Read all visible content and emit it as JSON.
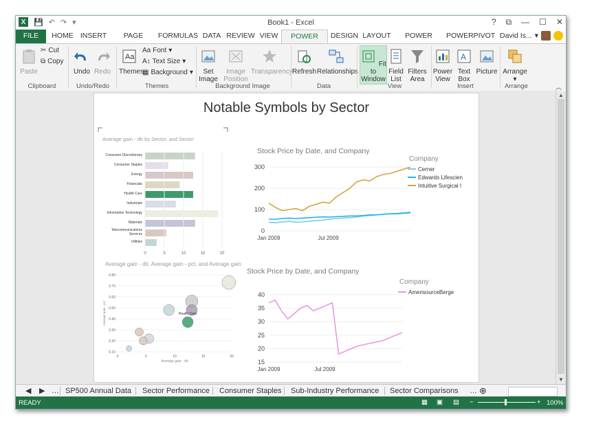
{
  "title_bar": {
    "title": "Book1 - Excel",
    "app_logo": "X",
    "controls": {
      "help": "?",
      "restore_ribbon": "⧉",
      "minimize": "—",
      "maximize": "☐",
      "close": "✕"
    }
  },
  "tabs": [
    "FILE",
    "HOME",
    "INSERT",
    "PAGE LAYOUT",
    "FORMULAS",
    "DATA",
    "REVIEW",
    "VIEW",
    "POWER VIEW",
    "DESIGN",
    "LAYOUT",
    "POWER QUERY",
    "POWERPIVOT"
  ],
  "active_tab": "POWER VIEW",
  "user": {
    "name": "David Is..."
  },
  "ribbon": {
    "clipboard": {
      "paste": "Paste",
      "cut": "Cut",
      "copy": "Copy",
      "label": "Clipboard"
    },
    "undoredo": {
      "undo": "Undo",
      "redo": "Redo",
      "label": "Undo/Redo"
    },
    "themes": {
      "themes": "Themes",
      "font": "Font",
      "text_size": "Text Size",
      "background": "Background",
      "label": "Themes"
    },
    "background_image": {
      "set_image_1": "Set",
      "set_image_2": "Image",
      "image_position_1": "Image",
      "image_position_2": "Position",
      "transparency": "Transparency",
      "label": "Background Image"
    },
    "data": {
      "refresh": "Refresh",
      "relationships": "Relationships",
      "label": "Data"
    },
    "view": {
      "fit_1": "Fit to",
      "fit_2": "Window",
      "field_1": "Field",
      "field_2": "List",
      "filters_1": "Filters",
      "filters_2": "Area",
      "label": "View"
    },
    "insert": {
      "pv_1": "Power",
      "pv_2": "View",
      "tb_1": "Text",
      "tb_2": "Box",
      "picture": "Picture",
      "label": "Insert"
    },
    "arrange": {
      "arrange": "Arrange",
      "label": "Arrange"
    }
  },
  "report": {
    "title": "Notable Symbols by Sector"
  },
  "chart_data": [
    {
      "type": "bar",
      "title": "Average gain - dlr by Sector, and Sector",
      "categories": [
        "Consumer Discretionary",
        "Consumer Staples",
        "Energy",
        "Financials",
        "Health Care",
        "Industrials",
        "Information Technology",
        "Materials",
        "Telecommunications Services",
        "Utilities"
      ],
      "values": [
        13,
        6,
        12.5,
        9,
        12.5,
        8,
        19,
        13,
        5.5,
        3
      ],
      "colors": [
        "#c8d4c8",
        "#e6dde8",
        "#d8c8c8",
        "#dcd8c4",
        "#3d9b6d",
        "#dadde6",
        "#eceee0",
        "#c4c4d8",
        "#d8c8c0",
        "#c4d4d8"
      ],
      "xticks": [
        "0",
        "5",
        "10",
        "15",
        "20"
      ],
      "xlim": [
        0,
        20
      ],
      "tick_labels": [
        [
          "Consumer Discretionary"
        ],
        [
          "Consumer Staples"
        ],
        [
          "Energy"
        ],
        [
          "Financials"
        ],
        [
          "Health Care"
        ],
        [
          "Industrials"
        ],
        [
          "Information Technology"
        ],
        [
          "Materials"
        ],
        [
          "Telecommunications",
          "Services"
        ],
        [
          "Utilities"
        ]
      ]
    },
    {
      "type": "scatter",
      "title": "Average gain - dlr, Average gain - pct, and Average gain",
      "xlabel": "Average gain - dlr",
      "ylabel": "Average gain - pct",
      "xlim": [
        0,
        20
      ],
      "ylim": [
        0.1,
        0.8
      ],
      "xticks": [
        "0",
        "5",
        "10",
        "15",
        "20"
      ],
      "yticks": [
        "0.10",
        "0.20",
        "0.30",
        "0.40",
        "0.50",
        "0.60",
        "0.70",
        "0.80"
      ],
      "points": [
        {
          "x": 19.5,
          "y": 0.73,
          "r": 10,
          "color": "#e6e8d8",
          "label": ""
        },
        {
          "x": 13,
          "y": 0.56,
          "r": 9,
          "color": "#d0c8c8",
          "label": ""
        },
        {
          "x": 13,
          "y": 0.48,
          "r": 8,
          "color": "#a89cb0",
          "label": ""
        },
        {
          "x": 12.3,
          "y": 0.37,
          "r": 8,
          "color": "#3d9b6d",
          "label": "Health Care"
        },
        {
          "x": 9,
          "y": 0.48,
          "r": 8,
          "color": "#c4d4d8",
          "label": ""
        },
        {
          "x": 5.5,
          "y": 0.22,
          "r": 7,
          "color": "#d8d4e0",
          "label": ""
        },
        {
          "x": 4.5,
          "y": 0.2,
          "r": 6,
          "color": "#d8c8c0",
          "label": ""
        },
        {
          "x": 3.8,
          "y": 0.28,
          "r": 6,
          "color": "#d8c8b8",
          "label": ""
        },
        {
          "x": 2.0,
          "y": 0.13,
          "r": 4,
          "color": "#c8d4dc",
          "label": ""
        }
      ]
    },
    {
      "type": "line",
      "title": "Stock Price by Date, and Company",
      "legend_title": "Company",
      "xticks": [
        "Jan 2009",
        "Jul 2009"
      ],
      "yticks": [
        "0",
        "100",
        "200",
        "300"
      ],
      "ylim": [
        0,
        310
      ],
      "series": [
        {
          "name": "Cerner",
          "color": "#7ec8e3",
          "values": [
            40,
            38,
            42,
            45,
            40,
            42,
            45,
            48,
            50,
            55,
            58,
            60,
            62,
            65,
            70,
            72,
            75,
            78,
            80,
            82,
            85,
            88
          ]
        },
        {
          "name": "Edwards Lifescien",
          "color": "#1fb6e8",
          "values": [
            55,
            55,
            58,
            60,
            58,
            60,
            62,
            64,
            66,
            65,
            67,
            68,
            70,
            70,
            72,
            75,
            76,
            78,
            80,
            80,
            83,
            85
          ]
        },
        {
          "name": "Intuitive Surgical I",
          "color": "#d4a642",
          "values": [
            130,
            110,
            95,
            100,
            105,
            95,
            115,
            125,
            135,
            130,
            160,
            180,
            200,
            230,
            240,
            235,
            255,
            265,
            270,
            280,
            290,
            300
          ]
        }
      ]
    },
    {
      "type": "line",
      "title": "Stock Price by Date, and Company",
      "legend_title": "Company",
      "xticks": [
        "Jan 2009",
        "Jul 2009"
      ],
      "yticks": [
        "15",
        "20",
        "25",
        "30",
        "35",
        "40"
      ],
      "ylim": [
        15,
        41
      ],
      "series": [
        {
          "name": "AmerisourceBerge",
          "color": "#e59ae0",
          "values": [
            37,
            38,
            34,
            31,
            33,
            35,
            36,
            34,
            35,
            36,
            37,
            18,
            19,
            20,
            21,
            21.5,
            22,
            22.5,
            23,
            24,
            25,
            26
          ]
        }
      ]
    }
  ],
  "sheet_tabs": [
    "SP500 Annual Data",
    "Sector Performance",
    "Consumer Staples",
    "Sub-Industry Performance",
    "Sector Comparisons"
  ],
  "status": {
    "text": "READY",
    "zoom": "100%"
  }
}
